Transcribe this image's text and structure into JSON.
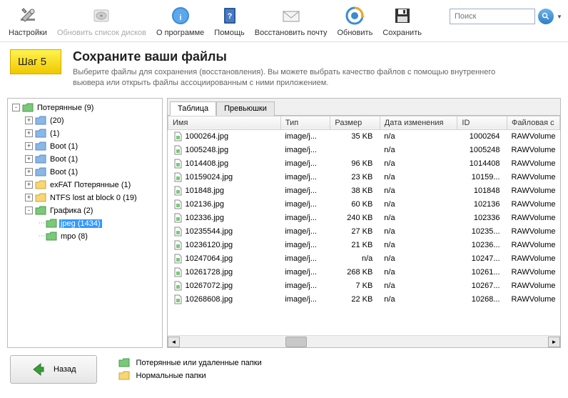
{
  "toolbar": {
    "settings": "Настройки",
    "refresh_disks": "Обновить список дисков",
    "about": "О программе",
    "help": "Помощь",
    "restore_mail": "Восстановить почту",
    "refresh": "Обновить",
    "save": "Сохранить",
    "search_placeholder": "Поиск"
  },
  "step": {
    "badge": "Шаг 5",
    "title": "Сохраните ваши файлы",
    "desc": "Выберите файлы для сохранения (восстановления). Вы можете выбрать качество файлов с помощью внутреннего вьювера или открыть файлы ассоциированным с ними приложением."
  },
  "tree": [
    {
      "depth": 0,
      "toggle": "-",
      "color": "green",
      "label": "Потерянные (9)"
    },
    {
      "depth": 1,
      "toggle": "+",
      "color": "blue",
      "label": " (20)"
    },
    {
      "depth": 1,
      "toggle": "+",
      "color": "blue",
      "label": " (1)"
    },
    {
      "depth": 1,
      "toggle": "+",
      "color": "blue",
      "label": "Boot (1)"
    },
    {
      "depth": 1,
      "toggle": "+",
      "color": "blue",
      "label": "Boot (1)"
    },
    {
      "depth": 1,
      "toggle": "+",
      "color": "blue",
      "label": "Boot (1)"
    },
    {
      "depth": 1,
      "toggle": "+",
      "color": "yellow",
      "label": "exFAT Потерянные (1)"
    },
    {
      "depth": 1,
      "toggle": "+",
      "color": "yellow",
      "label": "NTFS lost at block 0 (19)"
    },
    {
      "depth": 1,
      "toggle": "-",
      "color": "green",
      "label": "Графика (2)"
    },
    {
      "depth": 2,
      "toggle": ".",
      "color": "green",
      "label": "jpeg (1434)",
      "selected": true
    },
    {
      "depth": 2,
      "toggle": ".",
      "color": "green",
      "label": "mpo (8)"
    }
  ],
  "tabs": {
    "table": "Таблица",
    "thumbs": "Превьюшки"
  },
  "columns": {
    "name": "Имя",
    "type": "Тип",
    "size": "Размер",
    "date": "Дата изменения",
    "id": "ID",
    "fs": "Файловая с"
  },
  "rows": [
    {
      "name": "1000264.jpg",
      "type": "image/j...",
      "size": "35 KB",
      "date": "n/a",
      "id": "1000264",
      "fs": "RAWVolume"
    },
    {
      "name": "1005248.jpg",
      "type": "image/j...",
      "size": "",
      "date": "n/a",
      "id": "1005248",
      "fs": "RAWVolume"
    },
    {
      "name": "1014408.jpg",
      "type": "image/j...",
      "size": "96 KB",
      "date": "n/a",
      "id": "1014408",
      "fs": "RAWVolume"
    },
    {
      "name": "10159024.jpg",
      "type": "image/j...",
      "size": "23 KB",
      "date": "n/a",
      "id": "10159...",
      "fs": "RAWVolume"
    },
    {
      "name": "101848.jpg",
      "type": "image/j...",
      "size": "38 KB",
      "date": "n/a",
      "id": "101848",
      "fs": "RAWVolume"
    },
    {
      "name": "102136.jpg",
      "type": "image/j...",
      "size": "60 KB",
      "date": "n/a",
      "id": "102136",
      "fs": "RAWVolume"
    },
    {
      "name": "102336.jpg",
      "type": "image/j...",
      "size": "240 KB",
      "date": "n/a",
      "id": "102336",
      "fs": "RAWVolume"
    },
    {
      "name": "10235544.jpg",
      "type": "image/j...",
      "size": "27 KB",
      "date": "n/a",
      "id": "10235...",
      "fs": "RAWVolume"
    },
    {
      "name": "10236120.jpg",
      "type": "image/j...",
      "size": "21 KB",
      "date": "n/a",
      "id": "10236...",
      "fs": "RAWVolume"
    },
    {
      "name": "10247064.jpg",
      "type": "image/j...",
      "size": "n/a",
      "date": "n/a",
      "id": "10247...",
      "fs": "RAWVolume"
    },
    {
      "name": "10261728.jpg",
      "type": "image/j...",
      "size": "268 KB",
      "date": "n/a",
      "id": "10261...",
      "fs": "RAWVolume"
    },
    {
      "name": "10267072.jpg",
      "type": "image/j...",
      "size": "7 KB",
      "date": "n/a",
      "id": "10267...",
      "fs": "RAWVolume"
    },
    {
      "name": "10268608.jpg",
      "type": "image/j...",
      "size": "22 KB",
      "date": "n/a",
      "id": "10268...",
      "fs": "RAWVolume"
    }
  ],
  "footer": {
    "back": "Назад",
    "legend_lost": "Потерянные или удаленные папки",
    "legend_normal": "Нормальные папки"
  }
}
